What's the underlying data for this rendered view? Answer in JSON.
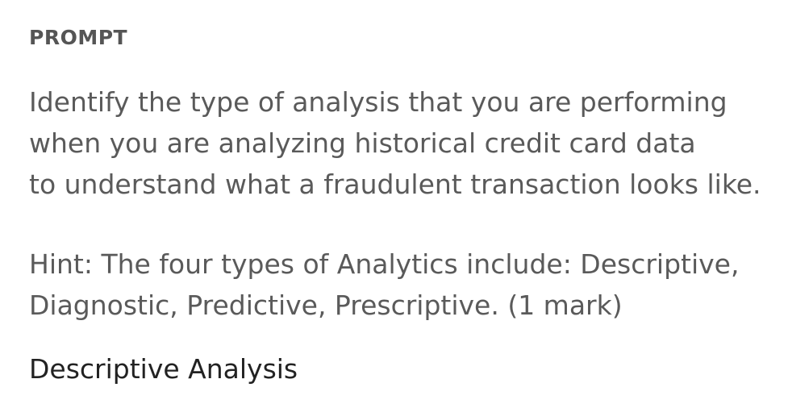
{
  "section_label": "PROMPT",
  "prompt": {
    "lines": [
      "Identify the type of analysis that you are performing",
      "when you are analyzing historical credit card data",
      "to understand what a fraudulent transaction looks like."
    ]
  },
  "hint": {
    "lines": [
      "Hint: The four types of Analytics include: Descriptive,",
      "Diagnostic, Predictive, Prescriptive. (1 mark)"
    ]
  },
  "answer": "Descriptive Analysis",
  "colors": {
    "label": "#555555",
    "body_text": "#5a5a5a",
    "answer_text": "#222222",
    "background": "#ffffff"
  }
}
